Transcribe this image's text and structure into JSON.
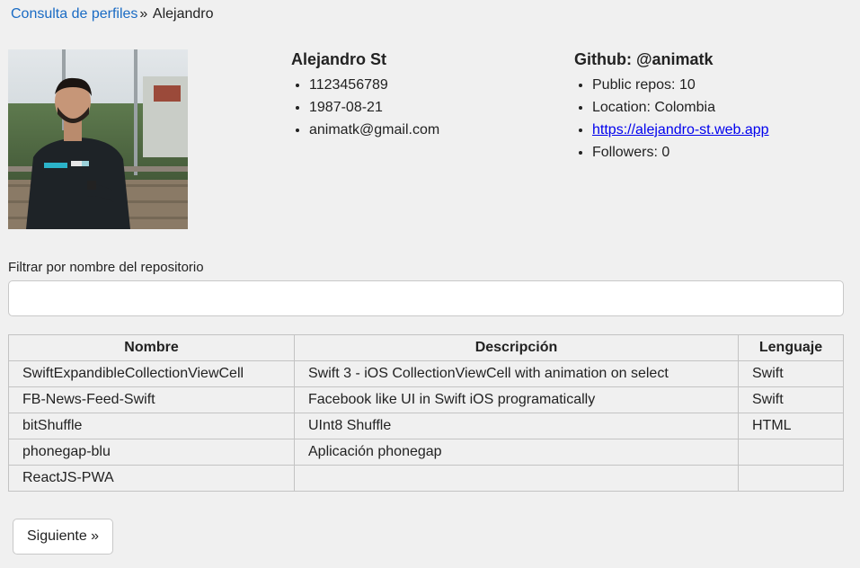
{
  "breadcrumb": {
    "link": "Consulta de perfiles",
    "separator": "»",
    "current": "Alejandro"
  },
  "profile": {
    "avatar": "profile-photo",
    "name": "Alejandro St",
    "items": [
      "1123456789",
      "1987-08-21",
      "animatk@gmail.com"
    ]
  },
  "github": {
    "title": "Github: @animatk",
    "public_repos": "Public repos: 10",
    "location": "Location: Colombia",
    "website": "https://alejandro-st.web.app",
    "followers": "Followers: 0"
  },
  "filter": {
    "label": "Filtrar por nombre del repositorio",
    "value": "",
    "placeholder": ""
  },
  "table": {
    "headers": [
      "Nombre",
      "Descripción",
      "Lenguaje"
    ],
    "rows": [
      [
        "SwiftExpandibleCollectionViewCell",
        "Swift 3 - iOS CollectionViewCell with animation on select",
        "Swift"
      ],
      [
        "FB-News-Feed-Swift",
        "Facebook like UI in Swift iOS programatically",
        "Swift"
      ],
      [
        "bitShuffle",
        "UInt8 Shuffle",
        "HTML"
      ],
      [
        "phonegap-blu",
        "Aplicación phonegap",
        ""
      ],
      [
        "ReactJS-PWA",
        "",
        ""
      ]
    ]
  },
  "pagination": {
    "next_label": "Siguiente »"
  },
  "colors": {
    "background": "#f0f0f0",
    "link": "#1a6bc4",
    "hyperlink": "#0000ee",
    "border": "#c3c3c3"
  }
}
